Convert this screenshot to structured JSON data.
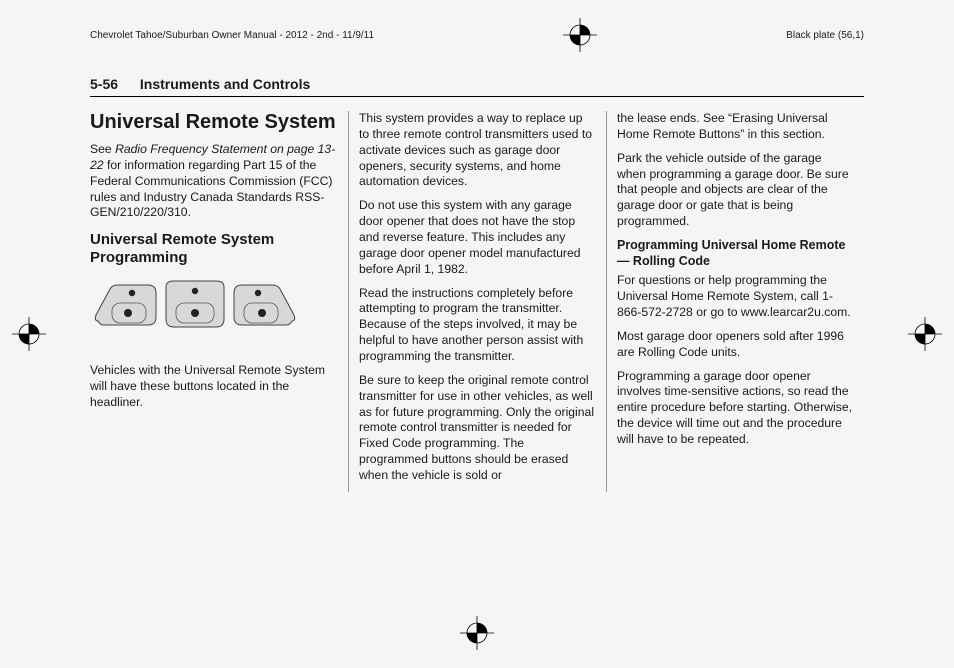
{
  "header": {
    "manual_ref": "Chevrolet Tahoe/Suburban Owner Manual - 2012 - 2nd - 11/9/11",
    "plate": "Black plate (56,1)"
  },
  "page": {
    "number": "5-56",
    "section_title": "Instruments and Controls"
  },
  "col1": {
    "title": "Universal Remote System",
    "p1a": "See ",
    "p1_italic": "Radio Frequency Statement on page 13-22",
    "p1b": " for information regarding Part 15 of the Federal Communications Commission (FCC) rules and Industry Canada Standards RSS-GEN/210/220/310.",
    "subtitle": "Universal Remote System Programming",
    "caption": "Vehicles with the Universal Remote System will have these buttons located in the headliner."
  },
  "col2": {
    "p1": "This system provides a way to replace up to three remote control transmitters used to activate devices such as garage door openers, security systems, and home automation devices.",
    "p2": "Do not use this system with any garage door opener that does not have the stop and reverse feature. This includes any garage door opener model manufactured before April 1, 1982.",
    "p3": "Read the instructions completely before attempting to program the transmitter. Because of the steps involved, it may be helpful to have another person assist with programming the transmitter.",
    "p4": "Be sure to keep the original remote control transmitter for use in other vehicles, as well as for future programming. Only the original remote control transmitter is needed for Fixed Code programming. The programmed buttons should be erased when the vehicle is sold or"
  },
  "col3": {
    "p1": "the lease ends. See “Erasing Universal Home Remote Buttons” in this section.",
    "p2": "Park the vehicle outside of the garage when programming a garage door. Be sure that people and objects are clear of the garage door or gate that is being programmed.",
    "h3": "Programming Universal Home Remote — Rolling Code",
    "p3": "For questions or help programming the Universal Home Remote System, call 1-866-572-2728 or go to www.learcar2u.com.",
    "p4": "Most garage door openers sold after 1996 are Rolling Code units.",
    "p5": "Programming a garage door opener involves time-sensitive actions, so read the entire procedure before starting. Otherwise, the device will time out and the procedure will have to be repeated."
  }
}
